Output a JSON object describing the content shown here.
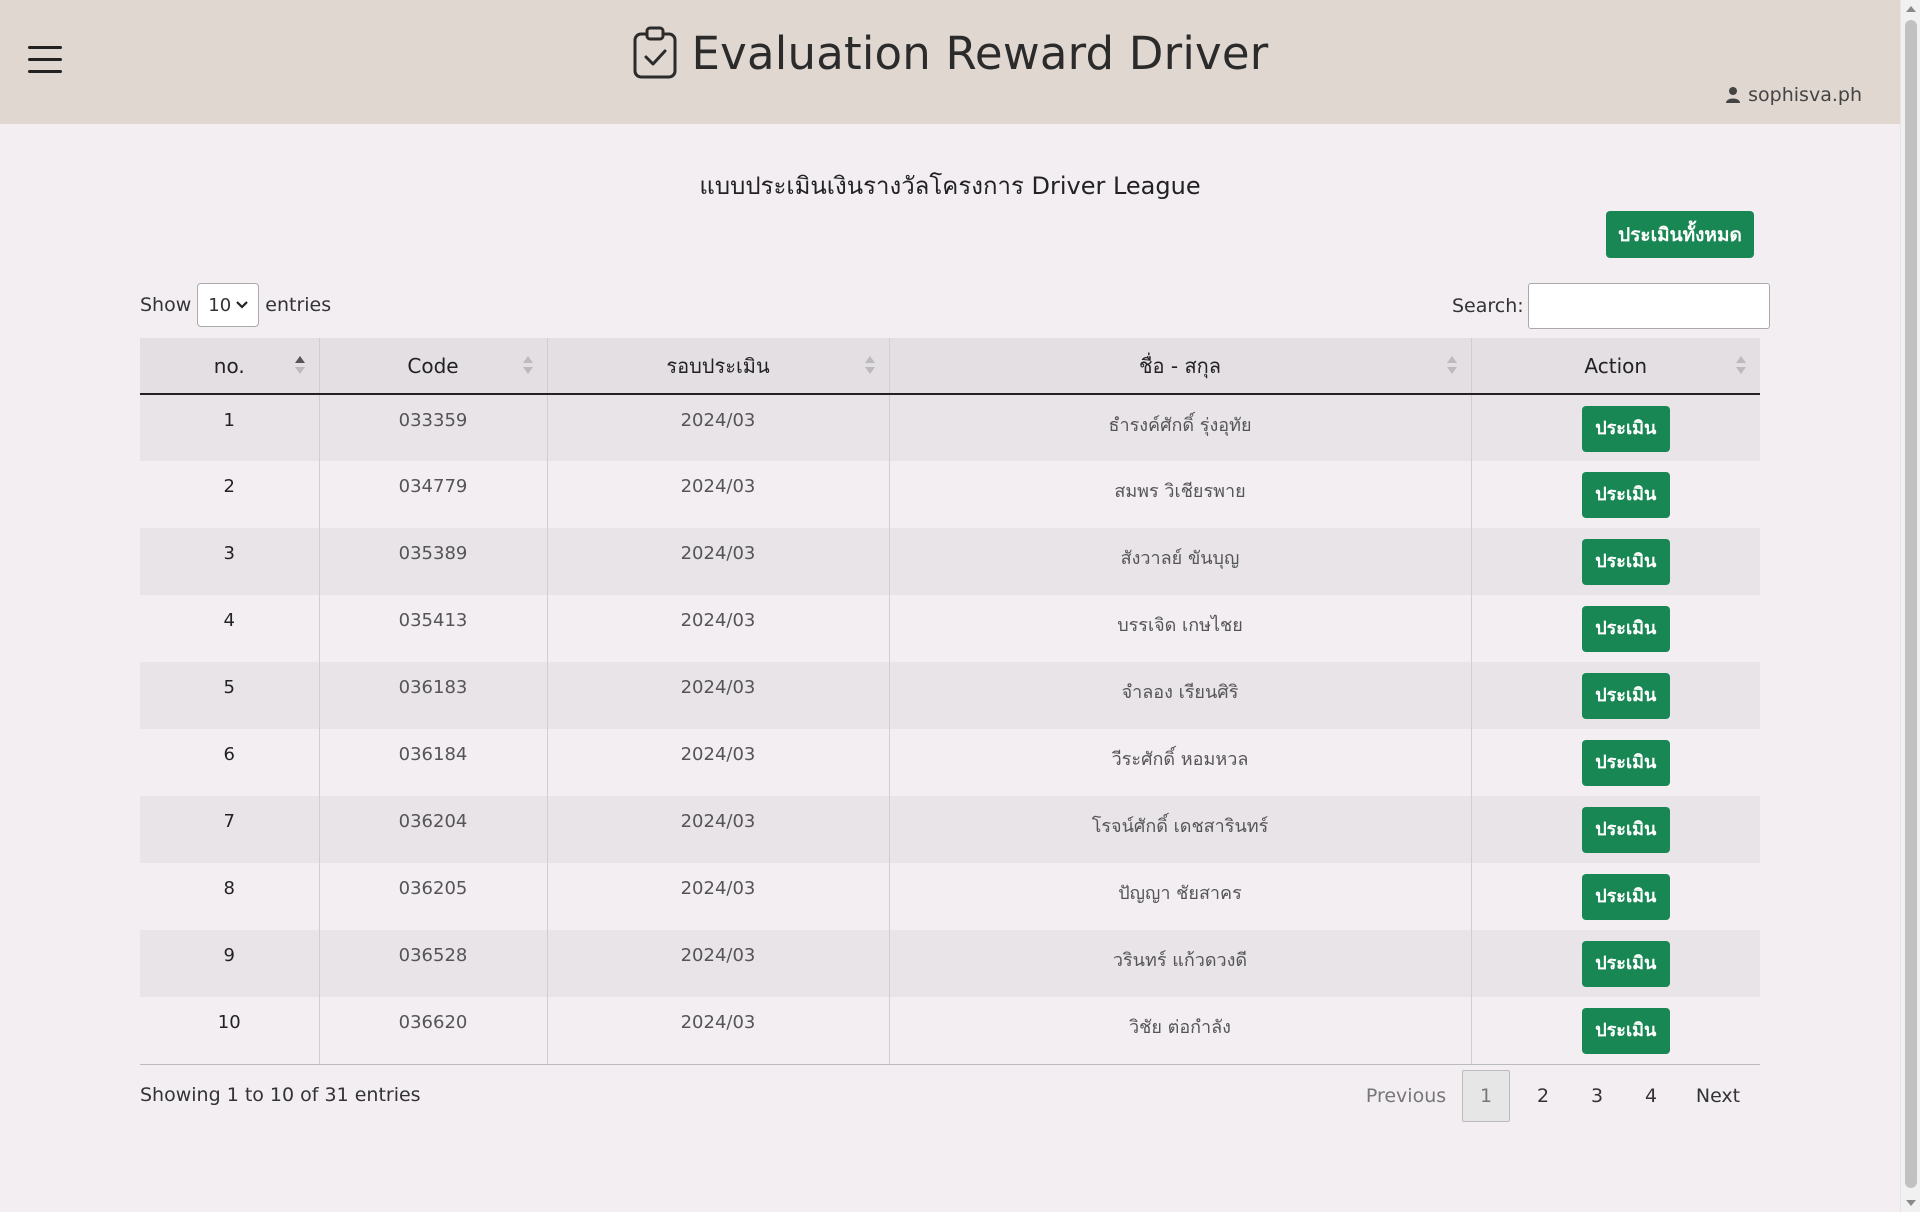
{
  "header": {
    "title": "Evaluation Reward Driver",
    "user": "sophisva.ph"
  },
  "main": {
    "form_title": "แบบประเมินเงินรางวัลโครงการ Driver League",
    "evaluate_all_label": "ประเมินทั้งหมด",
    "length": {
      "show": "Show",
      "value": "10",
      "entries": "entries"
    },
    "search_label": "Search:"
  },
  "table": {
    "headers": [
      "no.",
      "Code",
      "รอบประเมิน",
      "ชื่อ - สกุล",
      "Action"
    ],
    "action_label": "ประเมิน",
    "rows": [
      {
        "no": "1",
        "code": "033359",
        "round": "2024/03",
        "name": "ธำรงค์ศักดิ์ รุ่งอุทัย"
      },
      {
        "no": "2",
        "code": "034779",
        "round": "2024/03",
        "name": "สมพร วิเชียรพาย"
      },
      {
        "no": "3",
        "code": "035389",
        "round": "2024/03",
        "name": "สังวาลย์ ขันบุญ"
      },
      {
        "no": "4",
        "code": "035413",
        "round": "2024/03",
        "name": "บรรเจิด เกษไชย"
      },
      {
        "no": "5",
        "code": "036183",
        "round": "2024/03",
        "name": "จำลอง เรียนศิริ"
      },
      {
        "no": "6",
        "code": "036184",
        "round": "2024/03",
        "name": "วีระศักดิ์ หอมหวล"
      },
      {
        "no": "7",
        "code": "036204",
        "round": "2024/03",
        "name": "โรจน์ศักดิ์ เดชสารินทร์"
      },
      {
        "no": "8",
        "code": "036205",
        "round": "2024/03",
        "name": "ปัญญา ชัยสาคร"
      },
      {
        "no": "9",
        "code": "036528",
        "round": "2024/03",
        "name": "วรินทร์ แก้วดวงดี"
      },
      {
        "no": "10",
        "code": "036620",
        "round": "2024/03",
        "name": "วิชัย ต่อกำลัง"
      }
    ]
  },
  "footer": {
    "info": "Showing 1 to 10 of 31 entries",
    "pagination": {
      "previous": "Previous",
      "pages": [
        "1",
        "2",
        "3",
        "4"
      ],
      "next": "Next"
    }
  },
  "colors": {
    "header_bg": "#e0d7d1",
    "page_bg": "#f2eef2",
    "button": "#198754"
  },
  "icons": [
    "menu-icon",
    "clipboard-check-icon",
    "user-icon"
  ]
}
